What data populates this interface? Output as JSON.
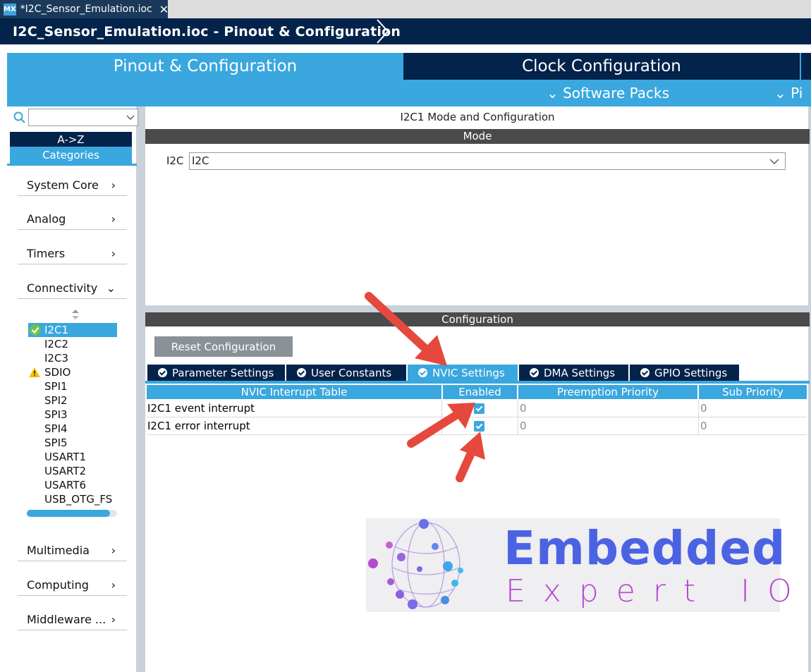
{
  "window_tab": {
    "badge": "MX",
    "title": "*I2C_Sensor_Emulation.ioc",
    "close": "✕"
  },
  "breadcrumb": {
    "text": "I2C_Sensor_Emulation.ioc - Pinout & Configuration"
  },
  "main_tabs": {
    "pinout": "Pinout & Configuration",
    "clock": "Clock Configuration"
  },
  "sub_bar": {
    "software_packs": "⌄ Software Packs",
    "pinout_more": "⌄ Pi"
  },
  "sidebar": {
    "az": "A->Z",
    "categories": "Categories",
    "items": [
      {
        "label": "System Core",
        "chev": "›"
      },
      {
        "label": "Analog",
        "chev": "›"
      },
      {
        "label": "Timers",
        "chev": "›"
      },
      {
        "label": "Connectivity",
        "chev": "⌄"
      },
      {
        "label": "Multimedia",
        "chev": "›"
      },
      {
        "label": "Computing",
        "chev": "›"
      },
      {
        "label": "Middleware ...",
        "chev": "›"
      }
    ],
    "peripherals": [
      "I2C1",
      "I2C2",
      "I2C3",
      "SDIO",
      "SPI1",
      "SPI2",
      "SPI3",
      "SPI4",
      "SPI5",
      "USART1",
      "USART2",
      "USART6",
      "USB_OTG_FS"
    ],
    "scroll_fraction": 0.92
  },
  "mode": {
    "title": "I2C1 Mode and Configuration",
    "header": "Mode",
    "i2c_label": "I2C",
    "i2c_value": "I2C"
  },
  "configuration": {
    "header": "Configuration",
    "reset_button": "Reset Configuration",
    "tabs": [
      "Parameter Settings",
      "User Constants",
      "NVIC Settings",
      "DMA Settings",
      "GPIO Settings"
    ],
    "active_tab": "NVIC Settings"
  },
  "nvic_table": {
    "headers": [
      "NVIC Interrupt Table",
      "Enabled",
      "Preemption Priority",
      "Sub Priority"
    ],
    "rows": [
      {
        "name": "I2C1 event interrupt",
        "enabled": true,
        "preemption": "0",
        "sub": "0"
      },
      {
        "name": "I2C1 error interrupt",
        "enabled": true,
        "preemption": "0",
        "sub": "0"
      }
    ]
  },
  "logo": {
    "line1": "Embedded",
    "line2": "Expert IO"
  },
  "colors": {
    "accent": "#3aa7de",
    "navy": "#03234b",
    "annotation": "#e5483c"
  }
}
